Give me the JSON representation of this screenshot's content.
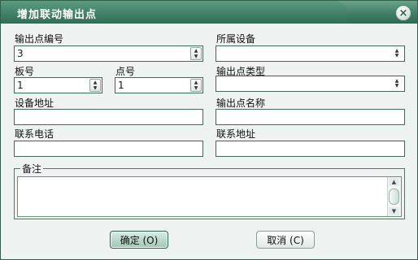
{
  "window": {
    "title": "增加联动输出点",
    "close_glyph": "×"
  },
  "form": {
    "output_point_no": {
      "label": "输出点编号",
      "value": "3"
    },
    "device": {
      "label": "所属设备",
      "value": ""
    },
    "board_no": {
      "label": "板号",
      "value": "1"
    },
    "point_no": {
      "label": "点号",
      "value": "1"
    },
    "output_type": {
      "label": "输出点类型",
      "value": ""
    },
    "device_address": {
      "label": "设备地址",
      "value": ""
    },
    "output_name": {
      "label": "输出点名称",
      "value": ""
    },
    "contact_phone": {
      "label": "联系电话",
      "value": ""
    },
    "contact_address": {
      "label": "联系地址",
      "value": ""
    },
    "remark": {
      "label": "备注",
      "value": ""
    }
  },
  "buttons": {
    "ok": "确定 (O)",
    "cancel": "取消 (C)"
  }
}
